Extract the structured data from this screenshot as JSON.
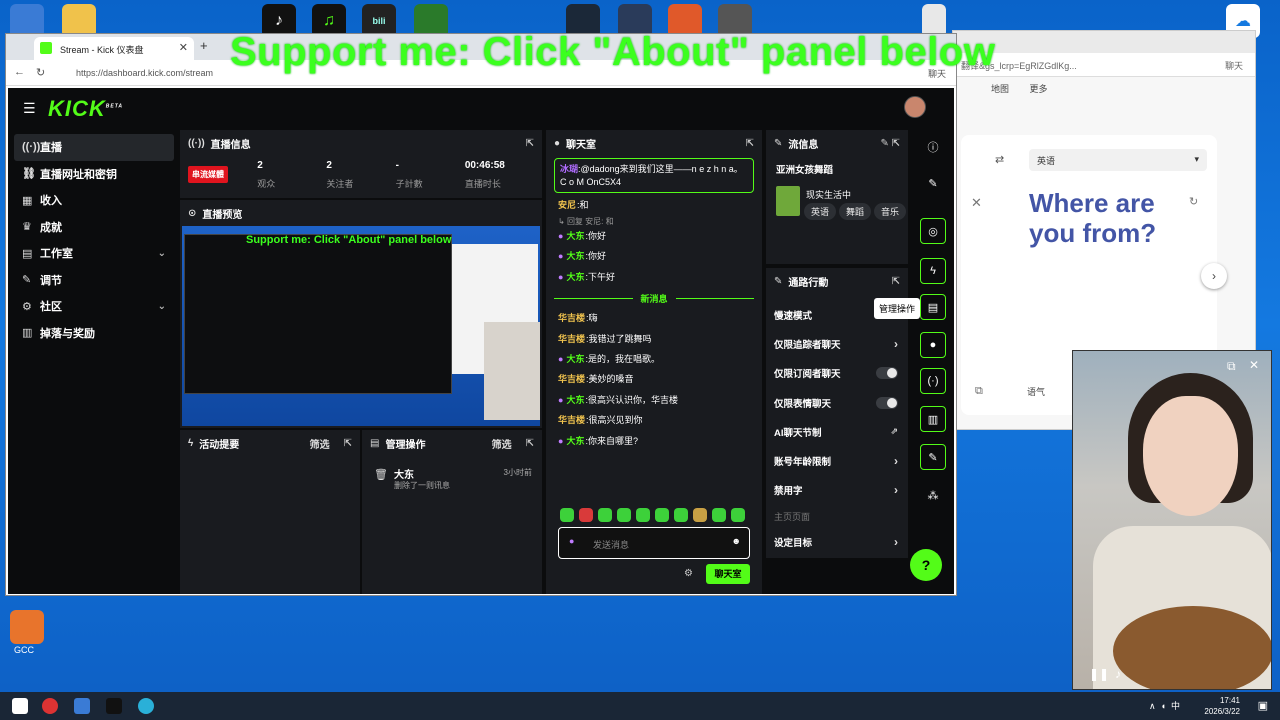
{
  "overlay_text": "Support me: Click \"About\" panel below",
  "browser": {
    "tab_title": "Stream - Kick 仪表盘",
    "url": "https://dashboard.kick.com/stream",
    "profile_label": "聊天"
  },
  "browser2": {
    "addr": "翻译&gs_lcrp=EgRlZGdlKg...",
    "profile_label": "聊天",
    "nav": [
      "地图",
      "更多"
    ],
    "target_lang": "英语",
    "translation": "Where are you from?",
    "footer_label": "语气"
  },
  "app": {
    "logo": "KICK",
    "logo_sup": "BETA",
    "sidebar": [
      {
        "icon": "broadcast-icon",
        "glyph": "((·))",
        "label": "直播",
        "active": true
      },
      {
        "icon": "link-icon",
        "glyph": "⛓",
        "label": "直播网址和密钥"
      },
      {
        "icon": "income-icon",
        "glyph": "▦",
        "label": "收入"
      },
      {
        "icon": "trophy-icon",
        "glyph": "🏆",
        "label": "成就"
      },
      {
        "icon": "studio-icon",
        "glyph": "▤",
        "label": "工作室",
        "chevron": true
      },
      {
        "icon": "wrench-icon",
        "glyph": "✎",
        "label": "调节"
      },
      {
        "icon": "community-icon",
        "glyph": "⚙",
        "label": "社区",
        "chevron": true
      },
      {
        "icon": "drops-icon",
        "glyph": "▥",
        "label": "掉落与奖励"
      }
    ],
    "stream_info": {
      "title": "直播信息",
      "live_badge": "串流媒體",
      "stats": [
        {
          "value": "2",
          "label": "观众"
        },
        {
          "value": "2",
          "label": "关注者"
        },
        {
          "value": "-",
          "label": "子計數"
        },
        {
          "value": "00:46:58",
          "label": "直播时长"
        }
      ]
    },
    "preview": {
      "title": "直播预览",
      "overlay": "Support me: Click \"About\" panel below"
    },
    "activity": {
      "title": "活动提要",
      "filter": "筛选"
    },
    "mod_actions": {
      "title": "管理操作",
      "filter": "筛选",
      "entry_user": "大东",
      "entry_text": "删除了一则讯息",
      "entry_time": "3小时前"
    },
    "chat": {
      "title": "聊天室",
      "pinned_user": "冰瑚",
      "pinned_text": ":@dadong来到我们这里——n e z h n a。C o M OnC5X4",
      "messages_before": [
        {
          "user": "安尼",
          "text": ":和",
          "color": "yellow",
          "mic": false
        }
      ],
      "reply_label": "回复 安尼: 和",
      "messages_mid": [
        {
          "user": "大东",
          "text": ":你好",
          "color": "green",
          "mic": true
        },
        {
          "user": "大东",
          "text": ":你好",
          "color": "green",
          "mic": true
        },
        {
          "user": "大东",
          "text": ":下午好",
          "color": "green",
          "mic": true
        }
      ],
      "new_messages_label": "新消息",
      "messages_after": [
        {
          "user": "华吉楼",
          "text": ":嗨",
          "color": "yellow",
          "mic": false
        },
        {
          "user": "华吉楼",
          "text": ":我错过了跳舞吗",
          "color": "yellow",
          "mic": false
        },
        {
          "user": "大东",
          "text": ":是的，我在唱歌。",
          "color": "green",
          "mic": true
        },
        {
          "user": "华吉楼",
          "text": ":美妙的嗓音",
          "color": "yellow",
          "mic": false
        },
        {
          "user": "大东",
          "text": ":很高兴认识你，华吉楼",
          "color": "green",
          "mic": true
        },
        {
          "user": "华吉楼",
          "text": ":很高兴见到你",
          "color": "yellow",
          "mic": false
        },
        {
          "user": "大东",
          "text": ":你来自哪里?",
          "color": "green",
          "mic": true
        }
      ],
      "input_placeholder": "发送消息",
      "send_button": "聊天室"
    },
    "stream_meta": {
      "title": "流信息",
      "stream_title": "亚洲女孩舞蹈",
      "category": "现实生活中",
      "tags": [
        "英语",
        "舞蹈",
        "音乐"
      ]
    },
    "moderation": {
      "title": "通路行動",
      "rows": [
        {
          "label": "慢速模式",
          "type": "none"
        },
        {
          "label": "仅限追踪者聊天",
          "type": "chevron"
        },
        {
          "label": "仅限订阅者聊天",
          "type": "toggle"
        },
        {
          "label": "仅限表情聊天",
          "type": "toggle"
        },
        {
          "label": "AI聊天节制",
          "type": "external"
        },
        {
          "label": "账号年龄限制",
          "type": "chevron"
        },
        {
          "label": "禁用字",
          "type": "chevron"
        },
        {
          "label": "主页页面",
          "type": "dim"
        },
        {
          "label": "设定目标",
          "type": "chevron"
        }
      ]
    },
    "tooltip": "管理操作"
  },
  "desktop": {
    "gcc_label": "GCC"
  },
  "taskbar": {
    "time": "17:41",
    "date": "2026/3/22",
    "ime": "中"
  }
}
